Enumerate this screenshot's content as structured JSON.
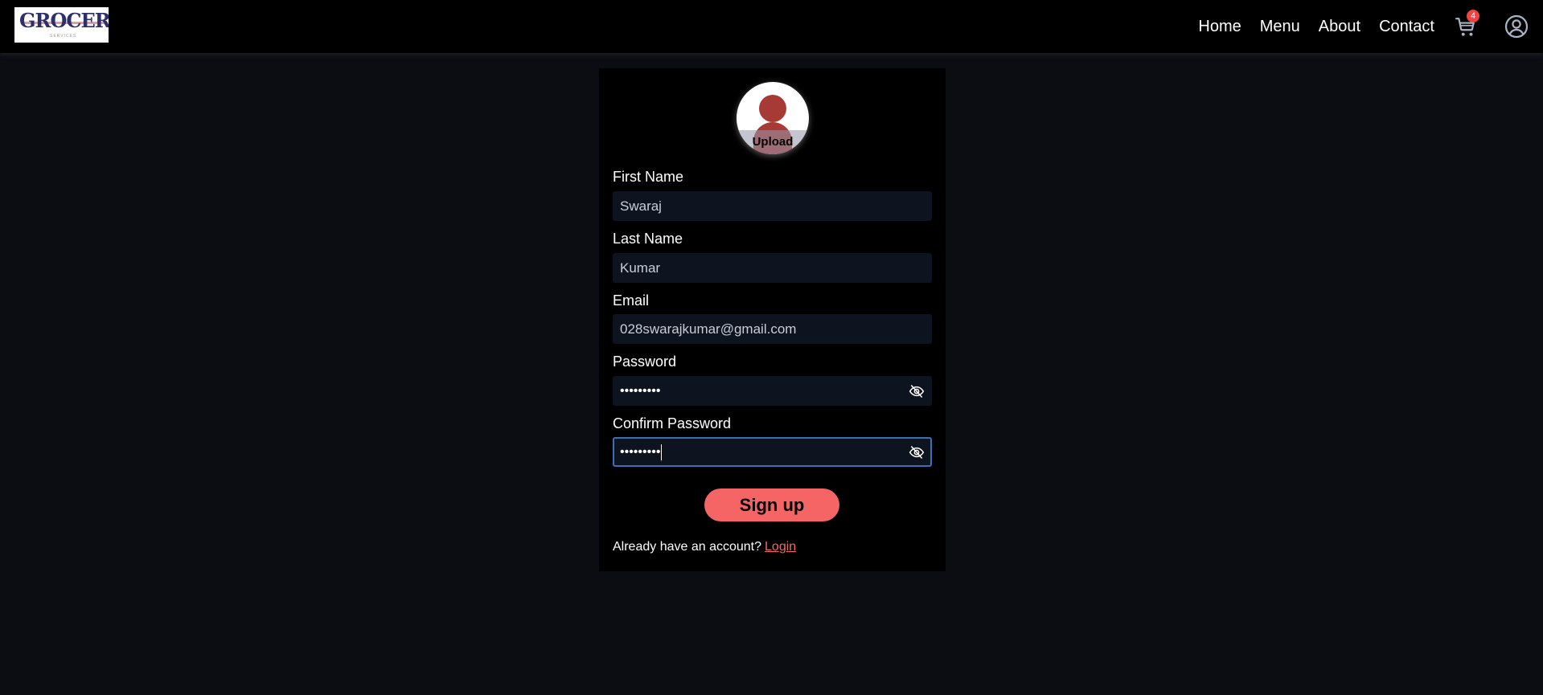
{
  "header": {
    "logo": {
      "text": "GROCERY",
      "subtext": "SERVICES"
    },
    "nav": [
      {
        "label": "Home"
      },
      {
        "label": "Menu"
      },
      {
        "label": "About"
      },
      {
        "label": "Contact"
      }
    ],
    "cart": {
      "icon": "shopping-cart-icon",
      "count": "4",
      "badge_color": "#ef4444"
    },
    "user_icon": "user-circle-icon"
  },
  "form": {
    "avatar": {
      "icon": "user-silhouette-icon",
      "label": "Upload"
    },
    "fields": [
      {
        "label": "First Name",
        "value": "Swaraj"
      },
      {
        "label": "Last Name",
        "value": "Kumar"
      },
      {
        "label": "Email",
        "value": "028swarajkumar@gmail.com"
      },
      {
        "label": "Password",
        "value": "•••••••••",
        "icon": "eye-off-icon"
      },
      {
        "label": "Confirm Password",
        "value": "•••••••••",
        "icon": "eye-off-icon",
        "focused": true
      }
    ],
    "submit_label": "Sign up",
    "footer": {
      "text": "Already have an account?",
      "link": "Login"
    }
  },
  "colors": {
    "accent": "#f56565",
    "background": "#0b0d12",
    "card": "#000000",
    "input_bg": "#0e1320",
    "focus_border": "#3b6fb6"
  }
}
